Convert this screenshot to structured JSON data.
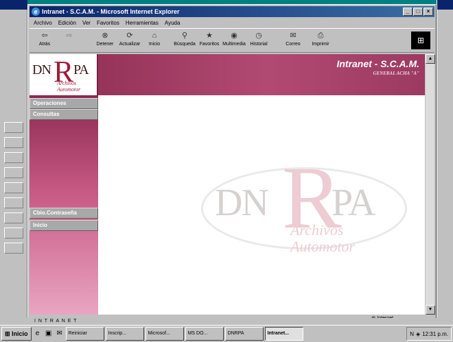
{
  "window": {
    "title": "Intranet - S.C.A.M. - Microsoft Internet Explorer",
    "controls": [
      "_",
      "□",
      "×"
    ]
  },
  "menu": [
    "Archivo",
    "Edición",
    "Ver",
    "Favoritos",
    "Herramientas",
    "Ayuda"
  ],
  "toolbar": [
    {
      "label": "Atrás",
      "icon": "back-icon",
      "glyph": "⇦",
      "enabled": true
    },
    {
      "label": "",
      "icon": "forward-icon",
      "glyph": "⇨",
      "enabled": false
    },
    {
      "label": "Detener",
      "icon": "stop-icon",
      "glyph": "⊗",
      "enabled": true
    },
    {
      "label": "Actualizar",
      "icon": "refresh-icon",
      "glyph": "⟳",
      "enabled": true
    },
    {
      "label": "Inicio",
      "icon": "home-icon",
      "glyph": "⌂",
      "enabled": true
    },
    {
      "label": "Búsqueda",
      "icon": "search-icon",
      "glyph": "⚲",
      "enabled": true
    },
    {
      "label": "Favoritos",
      "icon": "favorites-icon",
      "glyph": "★",
      "enabled": true
    },
    {
      "label": "Multimedia",
      "icon": "media-icon",
      "glyph": "◉",
      "enabled": true
    },
    {
      "label": "Historial",
      "icon": "history-icon",
      "glyph": "◷",
      "enabled": true
    },
    {
      "label": "Correo",
      "icon": "mail-icon",
      "glyph": "✉",
      "enabled": true
    },
    {
      "label": "Imprimir",
      "icon": "print-icon",
      "glyph": "⎙",
      "enabled": true
    }
  ],
  "page": {
    "logo_text": "DN",
    "logo_r": "R",
    "logo_pa": "PA",
    "logo_sub": "Archivos Automotor",
    "title": "Intranet - S.C.A.M.",
    "subtitle": "GENERAL ACHA \"A\"",
    "nav": [
      {
        "label": "Operaciones"
      },
      {
        "label": "Consultas"
      },
      {
        "label": "Cbio.Contraseña"
      },
      {
        "label": "Inicio"
      }
    ],
    "watermark": {
      "dn": "DN",
      "r": "R",
      "pa": "PA",
      "sub": "Archivos Automotor"
    }
  },
  "status": {
    "text": "",
    "zone": "Internet"
  },
  "bottom_label": "I N T R A N E T",
  "taskbar": {
    "start": "Inicio",
    "tasks": [
      "Reiniciar",
      "Inscrip...",
      "Microsof...",
      "MS DO...",
      "DNRPA",
      "Intranet..."
    ],
    "active_index": 5,
    "time": "12:31 p.m."
  },
  "colors": {
    "header_dark": "#8a2a4e",
    "header_mid": "#b14a72",
    "nav_bg": "#a8a8a8"
  }
}
